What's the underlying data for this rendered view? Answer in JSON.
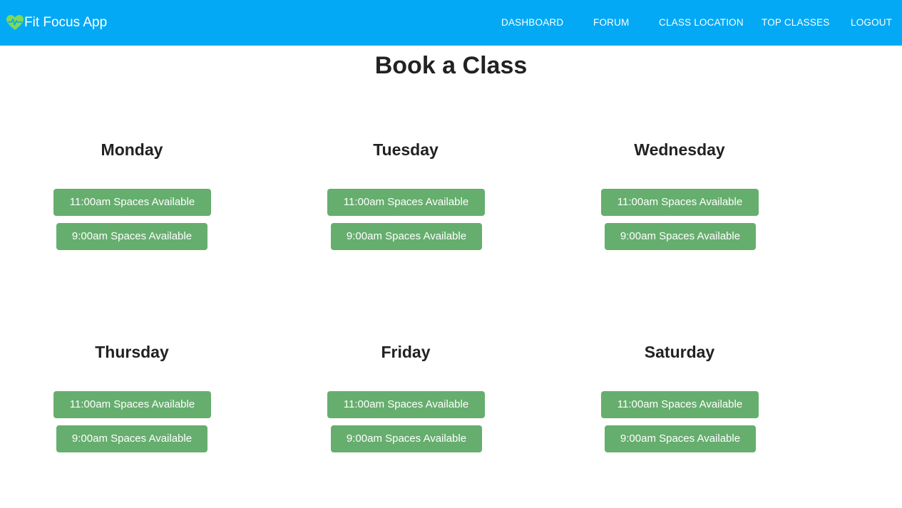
{
  "nav": {
    "brand": "Fit Focus App",
    "brand_icon": "heart-pulse-icon",
    "links": [
      "DASHBOARD",
      "FORUM",
      "CLASS LOCATION",
      "TOP CLASSES",
      "LOGOUT"
    ]
  },
  "colors": {
    "navbar": "#03a9f4",
    "slot_button": "#66ae6e",
    "logo": "#7ed957"
  },
  "page": {
    "title": "Book a Class"
  },
  "days": [
    {
      "name": "Monday",
      "slots": [
        "11:00am Spaces Available",
        "9:00am Spaces Available"
      ]
    },
    {
      "name": "Tuesday",
      "slots": [
        "11:00am Spaces Available",
        "9:00am Spaces Available"
      ]
    },
    {
      "name": "Wednesday",
      "slots": [
        "11:00am Spaces Available",
        "9:00am Spaces Available"
      ]
    },
    {
      "name": "Thursday",
      "slots": [
        "11:00am Spaces Available",
        "9:00am Spaces Available"
      ]
    },
    {
      "name": "Friday",
      "slots": [
        "11:00am Spaces Available",
        "9:00am Spaces Available"
      ]
    },
    {
      "name": "Saturday",
      "slots": [
        "11:00am Spaces Available",
        "9:00am Spaces Available"
      ]
    }
  ]
}
